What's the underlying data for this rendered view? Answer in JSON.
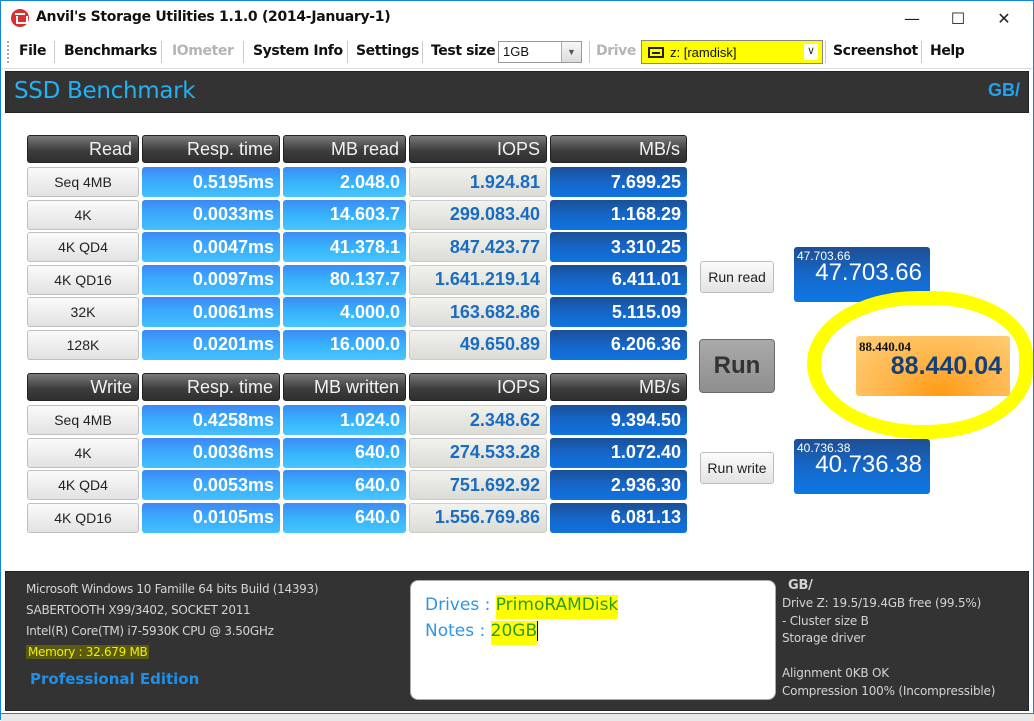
{
  "window": {
    "title": "Anvil's Storage Utilities 1.1.0 (2014-January-1)",
    "icon": "anvil-app-icon",
    "controls": {
      "minimize": "—",
      "maximize": "☐",
      "close": "✕"
    }
  },
  "menu": {
    "file": "File",
    "benchmarks": "Benchmarks",
    "iometer": "IOmeter",
    "system_info": "System Info",
    "settings": "Settings",
    "test_size_label": "Test size",
    "test_size_value": "1GB",
    "drive_label": "Drive",
    "drive_value": "z: [ramdisk]",
    "screenshot": "Screenshot",
    "help": "Help"
  },
  "header": {
    "title": "SSD Benchmark",
    "unit": "GB/"
  },
  "read_table": {
    "headers": [
      "Read",
      "Resp. time",
      "MB read",
      "IOPS",
      "MB/s"
    ],
    "rows": [
      {
        "label": "Seq 4MB",
        "resp": "0.5195ms",
        "mb": "2.048.0",
        "iops": "1.924.81",
        "mbs": "7.699.25"
      },
      {
        "label": "4K",
        "resp": "0.0033ms",
        "mb": "14.603.7",
        "iops": "299.083.40",
        "mbs": "1.168.29"
      },
      {
        "label": "4K QD4",
        "resp": "0.0047ms",
        "mb": "41.378.1",
        "iops": "847.423.77",
        "mbs": "3.310.25"
      },
      {
        "label": "4K QD16",
        "resp": "0.0097ms",
        "mb": "80.137.7",
        "iops": "1.641.219.14",
        "mbs": "6.411.01"
      },
      {
        "label": "32K",
        "resp": "0.0061ms",
        "mb": "4.000.0",
        "iops": "163.682.86",
        "mbs": "5.115.09"
      },
      {
        "label": "128K",
        "resp": "0.0201ms",
        "mb": "16.000.0",
        "iops": "49.650.89",
        "mbs": "6.206.36"
      }
    ]
  },
  "write_table": {
    "headers": [
      "Write",
      "Resp. time",
      "MB written",
      "IOPS",
      "MB/s"
    ],
    "rows": [
      {
        "label": "Seq 4MB",
        "resp": "0.4258ms",
        "mb": "1.024.0",
        "iops": "2.348.62",
        "mbs": "9.394.50"
      },
      {
        "label": "4K",
        "resp": "0.0036ms",
        "mb": "640.0",
        "iops": "274.533.28",
        "mbs": "1.072.40"
      },
      {
        "label": "4K QD4",
        "resp": "0.0053ms",
        "mb": "640.0",
        "iops": "751.692.92",
        "mbs": "2.936.30"
      },
      {
        "label": "4K QD16",
        "resp": "0.0105ms",
        "mb": "640.0",
        "iops": "1.556.769.86",
        "mbs": "6.081.13"
      }
    ]
  },
  "actions": {
    "run_read": "Run read",
    "run": "Run",
    "run_write": "Run write"
  },
  "scores": {
    "read_small": "47.703.66",
    "read_big": "47.703.66",
    "total_small": "88.440.04",
    "total_big": "88.440.04",
    "write_small": "40.736.38",
    "write_big": "40.736.38"
  },
  "system": {
    "os": "Microsoft Windows 10 Famille 64 bits Build (14393)",
    "board": "SABERTOOTH X99/3402, SOCKET 2011",
    "cpu": "Intel(R) Core(TM) i7-5930K CPU @ 3.50GHz",
    "memory": "Memory : 32.679 MB",
    "edition": "Professional Edition"
  },
  "notes": {
    "drives_label": "Drives : ",
    "drives_value": "PrimoRAMDisk",
    "notes_label": "Notes : ",
    "notes_value": "20GB"
  },
  "drive_info": {
    "unit": "GB/",
    "free": "Drive Z: 19.5/19.4GB free (99.5%)",
    "cluster": " - Cluster size B",
    "driver": "Storage driver",
    "alignment": "Alignment 0KB OK",
    "compression": "Compression 100% (Incompressible)"
  },
  "colors": {
    "accent_blue": "#21b2f5",
    "highlight_yellow": "#ffff00",
    "panel_dark": "#333333",
    "score_orange": "#ffa020"
  }
}
